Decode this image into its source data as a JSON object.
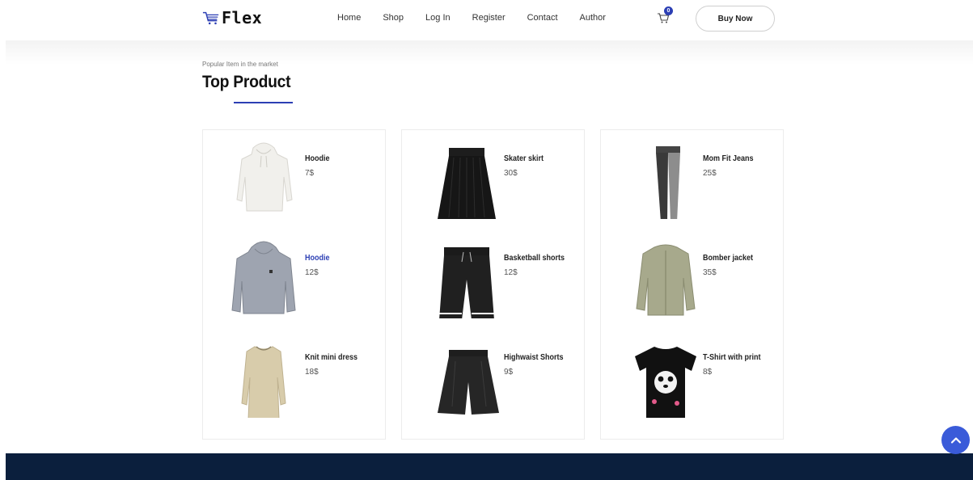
{
  "header": {
    "logo_text": "Flex",
    "nav": [
      "Home",
      "Shop",
      "Log In",
      "Register",
      "Contact",
      "Author"
    ],
    "cart_count": "0",
    "buy_now": "Buy Now"
  },
  "section": {
    "subtitle": "Popular Item in the market",
    "title": "Top Product"
  },
  "columns": [
    {
      "products": [
        {
          "name": "Hoodie",
          "price": "7$",
          "image": "white-hoodie"
        },
        {
          "name": "Hoodie",
          "price": "12$",
          "image": "grey-hoodie"
        },
        {
          "name": "Knit mini dress",
          "price": "18$",
          "image": "beige-knit-dress"
        }
      ]
    },
    {
      "products": [
        {
          "name": "Skater skirt",
          "price": "30$",
          "image": "black-skater-skirt"
        },
        {
          "name": "Basketball shorts",
          "price": "12$",
          "image": "black-basketball-shorts"
        },
        {
          "name": "Highwaist Shorts",
          "price": "9$",
          "image": "black-leather-shorts"
        }
      ]
    },
    {
      "products": [
        {
          "name": "Mom Fit Jeans",
          "price": "25$",
          "image": "grey-black-jeans"
        },
        {
          "name": "Bomber jacket",
          "price": "35$",
          "image": "olive-bomber-jacket"
        },
        {
          "name": "T-Shirt with print",
          "price": "8$",
          "image": "black-panda-tshirt"
        }
      ]
    }
  ],
  "colors": {
    "accent": "#2c3fb4",
    "footer": "#0b1f3d",
    "scroll_button": "#3a5bd9"
  },
  "icons": [
    "cart-icon",
    "logo-cart-icon",
    "chevron-up-icon"
  ]
}
